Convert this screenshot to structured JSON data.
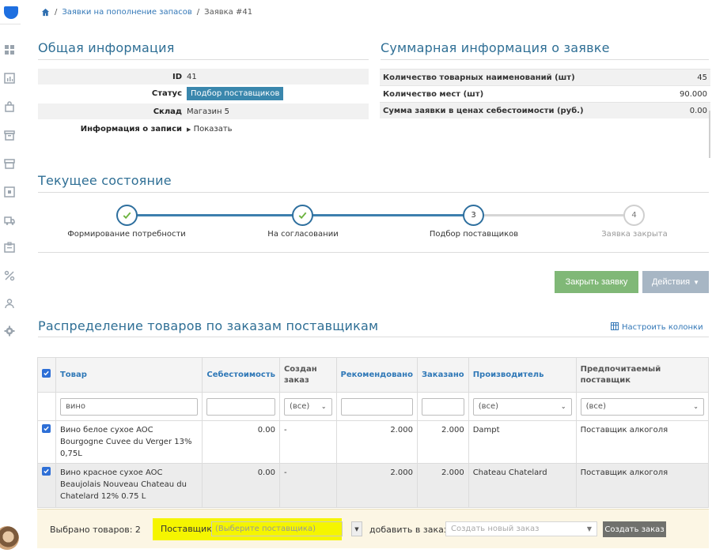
{
  "breadcrumb": {
    "items": [
      "Заявки на пополнение запасов",
      "Заявка #41"
    ],
    "separator": "/"
  },
  "general": {
    "title": "Общая информация",
    "rows": [
      {
        "label": "ID",
        "value": "41"
      },
      {
        "label": "Статус",
        "value": "Подбор поставщиков"
      },
      {
        "label": "Склад",
        "value": "Магазин 5"
      },
      {
        "label": "Информация о записи",
        "value": "Показать"
      }
    ]
  },
  "summary": {
    "title": "Суммарная информация о заявке",
    "rows": [
      {
        "label": "Количество товарных наименований (шт)",
        "value": "45"
      },
      {
        "label": "Количество мест (шт)",
        "value": "90.000"
      },
      {
        "label": "Сумма заявки в ценах себестоимости (руб.)",
        "value": "0.00"
      }
    ]
  },
  "state": {
    "title": "Текущее состояние",
    "steps": [
      {
        "label": "Формирование потребности",
        "status": "done"
      },
      {
        "label": "На согласовании",
        "status": "done"
      },
      {
        "label": "Подбор поставщиков",
        "status": "current",
        "number": "3"
      },
      {
        "label": "Заявка закрыта",
        "status": "pending",
        "number": "4"
      }
    ]
  },
  "actions": {
    "close_label": "Закрыть заявку",
    "actions_label": "Действия"
  },
  "distribution": {
    "title": "Распределение товаров по заказам поставщикам",
    "configure_label": "Настроить колонки",
    "headers": [
      "Товар",
      "Себестоимость",
      "Создан заказ",
      "Рекомендовано",
      "Заказано",
      "Производитель",
      "Предпочитаемый поставщик"
    ],
    "filters": {
      "product": "вино",
      "order": "(все)",
      "manufacturer": "(все)",
      "supplier": "(все)"
    },
    "rows": [
      {
        "product": "Вино белое сухое AOC Bourgogne Cuvee du Verger 13% 0,75L",
        "cost": "0.00",
        "order": "-",
        "recommended": "2.000",
        "ordered": "2.000",
        "manufacturer": "Dampt",
        "supplier": "Поставщик алкоголя"
      },
      {
        "product": "Вино красное сухое AOC Beaujolais Nouveau Chateau du Chatelard 12% 0.75 L",
        "cost": "0.00",
        "order": "-",
        "recommended": "2.000",
        "ordered": "2.000",
        "manufacturer": "Chateau Chatelard",
        "supplier": "Поставщик алкоголя"
      }
    ]
  },
  "footer": {
    "selected_label": "Выбрано товаров:",
    "selected_count": "2",
    "supplier_label": "Поставщик",
    "supplier_placeholder": "(Выберите поставщика)",
    "add_to_order_label": "добавить в заказ",
    "order_value": "Создать новый заказ",
    "create_label": "Создать заказ"
  },
  "colors": {
    "accent": "#2f6f95",
    "badge": "#3a87ad",
    "link": "#3277b7",
    "success": "#80b877",
    "highlight": "#f5f500",
    "checkbox": "#2e6fd6"
  }
}
